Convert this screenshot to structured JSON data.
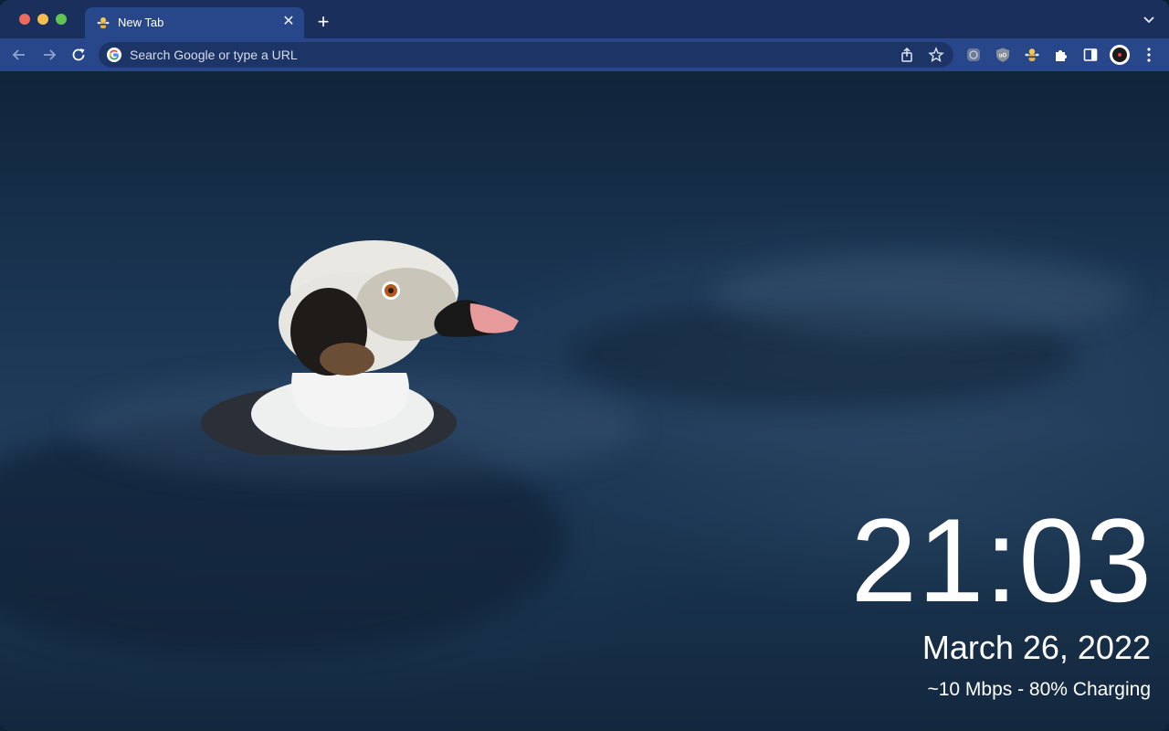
{
  "browser": {
    "tab": {
      "title": "New Tab",
      "favicon": "bee-mascot-icon",
      "close_icon": "close-icon"
    },
    "new_tab_icon": "plus-icon",
    "tab_search_icon": "chevron-down-icon",
    "toolbar": {
      "back_icon": "arrow-left-icon",
      "forward_icon": "arrow-right-icon",
      "reload_icon": "reload-icon",
      "omnibox": {
        "placeholder": "Search Google or type a URL",
        "provider_icon": "google-icon",
        "share_icon": "share-icon",
        "bookmark_icon": "star-icon"
      },
      "extensions": [
        "extension-shield-icon",
        "ublock-origin-icon",
        "bee-extension-icon",
        "puzzle-icon"
      ],
      "side_panel_icon": "side-panel-icon",
      "profile_icon": "avatar",
      "menu_icon": "kebab-menu-icon"
    },
    "colors": {
      "tabstrip": "#1b2f5c",
      "toolbar": "#28478a",
      "omnibox": "#1d3566"
    }
  },
  "newtab": {
    "background": "long-tailed duck swimming in dark blue water",
    "clock": "21:03",
    "date": "March 26, 2022",
    "status": "~10 Mbps - 80% Charging"
  }
}
